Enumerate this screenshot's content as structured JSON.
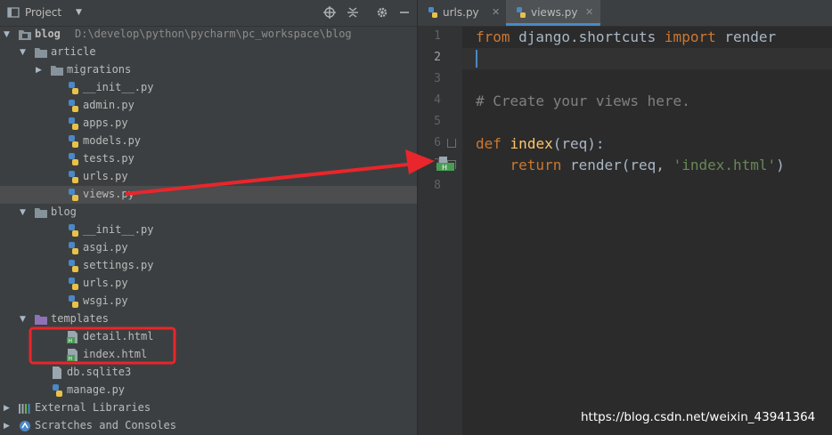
{
  "project_panel": {
    "title": "Project",
    "tree": [
      {
        "label": "blog",
        "path": "D:\\develop\\python\\pycharm\\pc_workspace\\blog",
        "kind": "root",
        "depth": 0,
        "expanded": true
      },
      {
        "label": "article",
        "kind": "folder",
        "depth": 1,
        "expanded": true
      },
      {
        "label": "migrations",
        "kind": "folder",
        "depth": 2,
        "expanded": false
      },
      {
        "label": "__init__.py",
        "kind": "py",
        "depth": 3
      },
      {
        "label": "admin.py",
        "kind": "py",
        "depth": 3
      },
      {
        "label": "apps.py",
        "kind": "py",
        "depth": 3
      },
      {
        "label": "models.py",
        "kind": "py",
        "depth": 3
      },
      {
        "label": "tests.py",
        "kind": "py",
        "depth": 3
      },
      {
        "label": "urls.py",
        "kind": "py",
        "depth": 3
      },
      {
        "label": "views.py",
        "kind": "py",
        "depth": 3,
        "selected": true
      },
      {
        "label": "blog",
        "kind": "folder",
        "depth": 1,
        "expanded": true
      },
      {
        "label": "__init__.py",
        "kind": "py",
        "depth": 3
      },
      {
        "label": "asgi.py",
        "kind": "py",
        "depth": 3
      },
      {
        "label": "settings.py",
        "kind": "py",
        "depth": 3
      },
      {
        "label": "urls.py",
        "kind": "py",
        "depth": 3
      },
      {
        "label": "wsgi.py",
        "kind": "py",
        "depth": 3
      },
      {
        "label": "templates",
        "kind": "folder-purple",
        "depth": 1,
        "expanded": true
      },
      {
        "label": "detail.html",
        "kind": "html",
        "depth": 3
      },
      {
        "label": "index.html",
        "kind": "html",
        "depth": 3
      },
      {
        "label": "db.sqlite3",
        "kind": "db",
        "depth": 2
      },
      {
        "label": "manage.py",
        "kind": "py",
        "depth": 2
      },
      {
        "label": "External Libraries",
        "kind": "libs",
        "depth": 0,
        "expanded": false
      },
      {
        "label": "Scratches and Consoles",
        "kind": "scratch",
        "depth": 0,
        "expanded": false
      }
    ]
  },
  "editor": {
    "tabs": [
      {
        "label": "urls.py",
        "active": false
      },
      {
        "label": "views.py",
        "active": true
      }
    ],
    "current_line": 2,
    "lines": [
      {
        "num": "1",
        "tokens": [
          {
            "t": "from",
            "c": "kw"
          },
          {
            "t": " django.shortcuts ",
            "c": ""
          },
          {
            "t": "import",
            "c": "kw"
          },
          {
            "t": " render",
            "c": ""
          }
        ]
      },
      {
        "num": "2",
        "tokens": []
      },
      {
        "num": "3",
        "tokens": []
      },
      {
        "num": "4",
        "tokens": [
          {
            "t": "# Create your views here.",
            "c": "cm"
          }
        ]
      },
      {
        "num": "5",
        "tokens": []
      },
      {
        "num": "6",
        "tokens": [
          {
            "t": "def",
            "c": "kw"
          },
          {
            "t": " ",
            "c": ""
          },
          {
            "t": "index",
            "c": "fn"
          },
          {
            "t": "(req):",
            "c": ""
          }
        ]
      },
      {
        "num": "7",
        "tokens": [
          {
            "t": "    ",
            "c": ""
          },
          {
            "t": "return",
            "c": "kw"
          },
          {
            "t": " render(req, ",
            "c": ""
          },
          {
            "t": "'index.html'",
            "c": "str"
          },
          {
            "t": ")",
            "c": ""
          }
        ]
      },
      {
        "num": "8",
        "tokens": []
      }
    ]
  },
  "annotations": {
    "arrow_color": "#e8262b",
    "box_color": "#e8262b"
  },
  "watermark": "https://blog.csdn.net/weixin_43941364"
}
